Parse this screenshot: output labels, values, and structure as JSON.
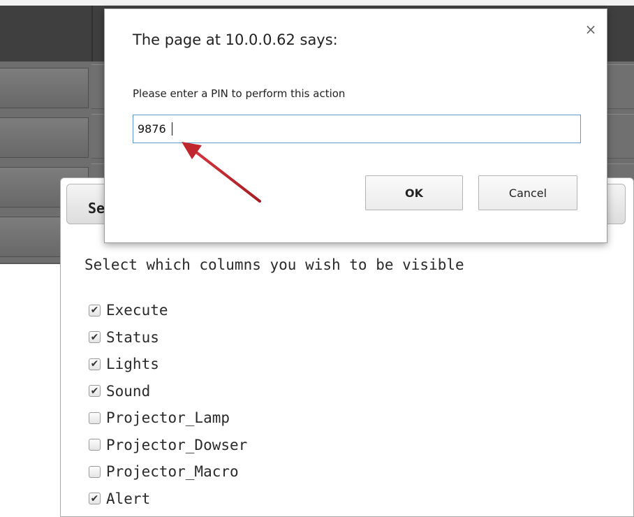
{
  "prompt_dialog": {
    "title": "The page at 10.0.0.62 says:",
    "message": "Please enter a PIN to perform this action",
    "input_value": "9876",
    "ok_label": "OK",
    "cancel_label": "Cancel",
    "close_glyph": "×"
  },
  "column_dialog": {
    "title": "Se",
    "prompt": "Select which columns you wish to be visible",
    "columns": [
      {
        "label": "Execute",
        "checked": true
      },
      {
        "label": "Status",
        "checked": true
      },
      {
        "label": "Lights",
        "checked": true
      },
      {
        "label": "Sound",
        "checked": true
      },
      {
        "label": "Projector_Lamp",
        "checked": false
      },
      {
        "label": "Projector_Dowser",
        "checked": false
      },
      {
        "label": "Projector_Macro",
        "checked": false
      },
      {
        "label": "Alert",
        "checked": true
      }
    ]
  },
  "annotation": {
    "color": "#c0262d",
    "icon": "arrow-icon"
  },
  "colors": {
    "header_bg": "#3f3f3f",
    "grid_bg": "#6e6e6e",
    "input_focus": "#5b9bd5"
  }
}
